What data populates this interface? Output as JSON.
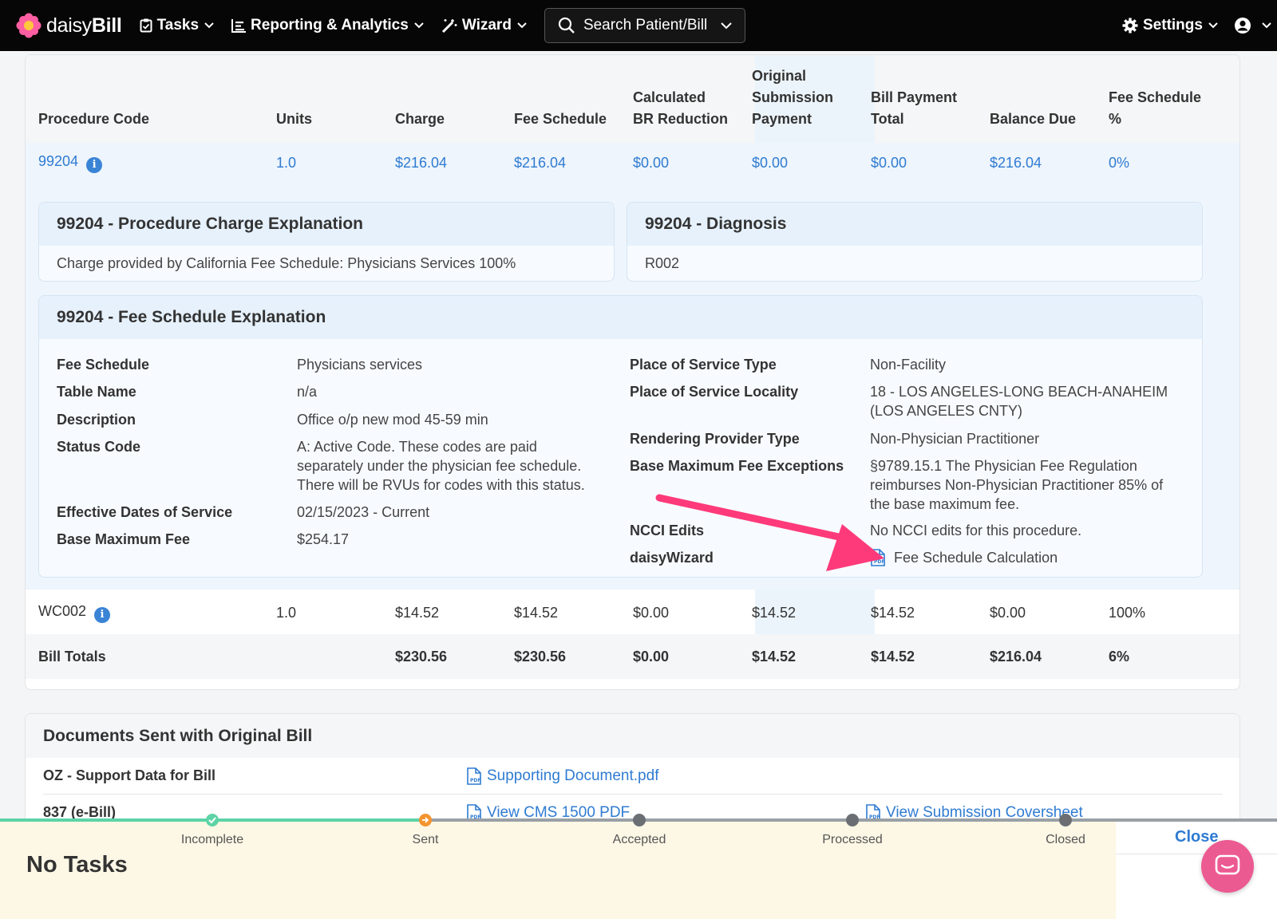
{
  "nav": {
    "brand_light": "daisy",
    "brand_bold": "Bill",
    "tasks": "Tasks",
    "reporting": "Reporting & Analytics",
    "wizard": "Wizard",
    "search": "Search Patient/Bill",
    "settings": "Settings"
  },
  "table": {
    "headers": {
      "procedure_code": "Procedure Code",
      "units": "Units",
      "charge": "Charge",
      "fee_schedule": "Fee Schedule",
      "calc_br_1": "Calculated",
      "calc_br_2": "BR Reduction",
      "orig_1": "Original",
      "orig_2": "Submission",
      "orig_3": "Payment",
      "bill_pay_1": "Bill Payment",
      "bill_pay_2": "Total",
      "balance_due": "Balance Due",
      "fs_pct_1": "Fee Schedule",
      "fs_pct_2": "%"
    },
    "rows": [
      {
        "code": "99204",
        "units": "1.0",
        "charge": "$216.04",
        "fee_schedule": "$216.04",
        "br_reduction": "$0.00",
        "orig_payment": "$0.00",
        "bill_payment": "$0.00",
        "balance_due": "$216.04",
        "fs_pct": "0%"
      },
      {
        "code": "WC002",
        "units": "1.0",
        "charge": "$14.52",
        "fee_schedule": "$14.52",
        "br_reduction": "$0.00",
        "orig_payment": "$14.52",
        "bill_payment": "$14.52",
        "balance_due": "$0.00",
        "fs_pct": "100%"
      }
    ],
    "totals": {
      "label": "Bill Totals",
      "charge": "$230.56",
      "fee_schedule": "$230.56",
      "br_reduction": "$0.00",
      "orig_payment": "$14.52",
      "bill_payment": "$14.52",
      "balance_due": "$216.04",
      "fs_pct": "6%"
    }
  },
  "charge_explanation": {
    "title": "99204 - Procedure Charge Explanation",
    "text": "Charge provided by California Fee Schedule: Physicians Services 100%"
  },
  "diagnosis": {
    "title": "99204 - Diagnosis",
    "text": "R002"
  },
  "fee_explanation": {
    "title": "99204 - Fee Schedule Explanation",
    "left": [
      {
        "label": "Fee Schedule",
        "value": "Physicians services"
      },
      {
        "label": "Table Name",
        "value": "n/a"
      },
      {
        "label": "Description",
        "value": "Office o/p new mod 45-59 min"
      },
      {
        "label": "Status Code",
        "value_1": "A: Active Code. These codes are paid",
        "value_2": "separately under the physician fee schedule.",
        "value_3": "There will be RVUs for codes with this status."
      },
      {
        "label": "Effective Dates of Service",
        "value": "02/15/2023 - Current"
      },
      {
        "label": "Base Maximum Fee",
        "value": "$254.17"
      }
    ],
    "right": [
      {
        "label": "Place of Service Type",
        "value": "Non-Facility"
      },
      {
        "label": "Place of Service Locality",
        "value_1": "18 - LOS ANGELES-LONG BEACH-ANAHEIM",
        "value_2": "(LOS ANGELES CNTY)"
      },
      {
        "label": "Rendering Provider Type",
        "value": "Non-Physician Practitioner"
      },
      {
        "label": "Base Maximum Fee Exceptions",
        "value_1": "§9789.15.1 The Physician Fee Regulation",
        "value_2": "reimburses Non-Physician Practitioner 85% of",
        "value_3": "the base maximum fee."
      },
      {
        "label": "NCCI Edits",
        "value": "No NCCI edits for this procedure."
      },
      {
        "label": "daisyWizard",
        "value": "Fee Schedule Calculation"
      }
    ]
  },
  "documents": {
    "title": "Documents Sent with Original Bill",
    "rows": [
      {
        "label": "OZ - Support Data for Bill",
        "link1": "Supporting Document.pdf"
      },
      {
        "label": "837 (e-Bill)",
        "link1": "View CMS 1500 PDF",
        "link2": "View Submission Coversheet"
      }
    ]
  },
  "status_bar": {
    "steps": [
      "Incomplete",
      "Sent",
      "Accepted",
      "Processed",
      "Closed"
    ],
    "no_tasks": "No Tasks",
    "close": "Close"
  },
  "colors": {
    "navbar": "#060606",
    "link": "#2f7bd2",
    "accent_pink": "#ff3a7a",
    "step_done": "#5dd3a6",
    "step_current": "#f5942f"
  }
}
